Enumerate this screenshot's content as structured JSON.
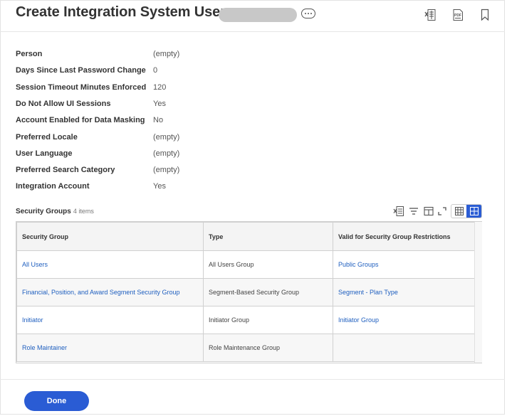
{
  "header": {
    "title": "Create Integration System User",
    "icons": [
      "export-to-excel-icon",
      "export-to-pdf-icon",
      "bookmark-icon"
    ],
    "pdf_label": "PDF"
  },
  "fields": [
    {
      "label": "Person",
      "value": "(empty)"
    },
    {
      "label": "Days Since Last Password Change",
      "value": "0"
    },
    {
      "label": "Session Timeout Minutes Enforced",
      "value": "120"
    },
    {
      "label": "Do Not Allow UI Sessions",
      "value": "Yes"
    },
    {
      "label": "Account Enabled for Data Masking",
      "value": "No"
    },
    {
      "label": "Preferred Locale",
      "value": "(empty)"
    },
    {
      "label": "User Language",
      "value": "(empty)"
    },
    {
      "label": "Preferred Search Category",
      "value": "(empty)"
    },
    {
      "label": "Integration Account",
      "value": "Yes"
    }
  ],
  "security_groups": {
    "title": "Security Groups",
    "count": "4 items",
    "columns": [
      "Security Group",
      "Type",
      "Valid for Security Group Restrictions"
    ],
    "rows": [
      [
        "All Users",
        "All Users Group",
        "Public Groups"
      ],
      [
        "Financial, Position, and Award Segment Security Group",
        "Segment-Based Security Group",
        "Segment - Plan Type"
      ],
      [
        "Initiator",
        "Initiator Group",
        "Initiator Group"
      ],
      [
        "Role Maintainer",
        "Role Maintenance Group",
        ""
      ]
    ],
    "link_color": "#1f5fbf"
  },
  "footer": {
    "done_label": "Done",
    "accent": "#2a5cd4"
  }
}
